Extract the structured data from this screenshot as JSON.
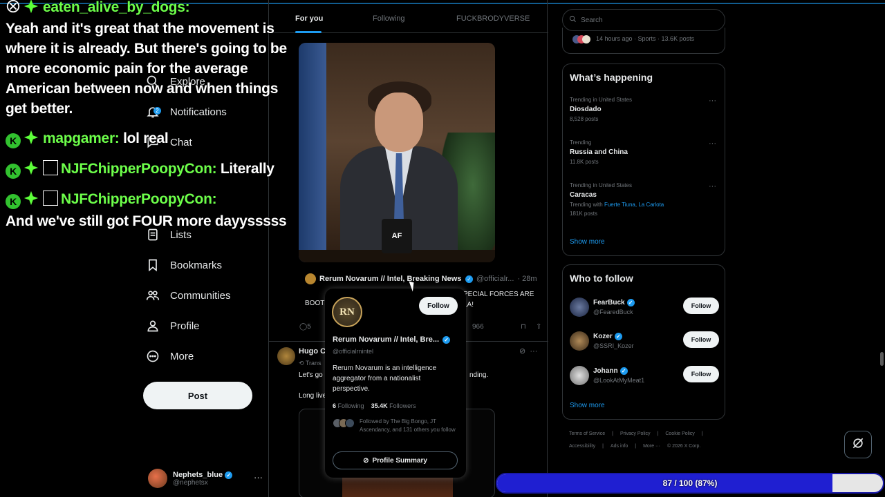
{
  "nav": {
    "items": [
      {
        "label": "Explore",
        "icon": "search-icon"
      },
      {
        "label": "Notifications",
        "icon": "bell-icon",
        "badge": "2"
      },
      {
        "label": "Chat",
        "icon": "chat-icon"
      },
      {
        "label": "Lists",
        "icon": "list-icon"
      },
      {
        "label": "Bookmarks",
        "icon": "bookmark-icon"
      },
      {
        "label": "Communities",
        "icon": "communities-icon"
      },
      {
        "label": "Profile",
        "icon": "profile-icon"
      },
      {
        "label": "More",
        "icon": "more-circle-icon"
      }
    ],
    "post_label": "Post",
    "account": {
      "name": "Nephets_blue",
      "handle": "@nephetsx",
      "more": "···"
    }
  },
  "feed": {
    "tabs": [
      "For you",
      "Following",
      "FUCKBRODYVERSE"
    ],
    "video": {
      "mug_text": "AF"
    },
    "tweet1": {
      "name": "Rerum Novarum // Intel, Breaking News, ...",
      "handle": "@officialr...",
      "time": "· 28m",
      "text_left": "BOOTS",
      "text_right": "PECIAL FORCES ARE\nLA!",
      "replies": "5",
      "views": "966"
    },
    "tweet2": {
      "name": "Hugo Co",
      "translate": "Trans",
      "text1": "Let's go l",
      "text1_end": "nding.",
      "text2": "Long live"
    }
  },
  "hovercard": {
    "avatar_text": "RN",
    "follow_label": "Follow",
    "name": "Rerum Novarum // Intel, Bre...",
    "handle": "@officialrnintel",
    "bio": "Rerum Novarum is an intelligence aggregator from a nationalist perspective.",
    "following_count": "6",
    "following_label": "Following",
    "followers_count": "35.4K",
    "followers_label": "Followers",
    "followed_by": "Followed by The Big Bongo, JT Ascendancy, and 131 others you follow",
    "summary_label": "Profile Summary"
  },
  "right": {
    "search_placeholder": "Search",
    "prev_meta": "14 hours ago · Sports · 13.6K posts",
    "happening": {
      "title": "What’s happening",
      "trends": [
        {
          "context": "Trending in United States",
          "name": "Diosdado",
          "count": "8,528 posts"
        },
        {
          "context": "Trending",
          "name": "Russia and China",
          "count": "11.8K posts"
        },
        {
          "context": "Trending in United States",
          "name": "Caracas",
          "with_label": "Trending with",
          "with_links": "Fuerte Tiuna, La Carlota",
          "count": "181K posts"
        }
      ],
      "show_more": "Show more"
    },
    "who_to_follow": {
      "title": "Who to follow",
      "users": [
        {
          "name": "FearBuck",
          "handle": "@FearedBuck",
          "button": "Follow"
        },
        {
          "name": "Kozer",
          "handle": "@SSRI_Kozer",
          "button": "Follow"
        },
        {
          "name": "Johann",
          "handle": "@LookAtMyMeat1",
          "button": "Follow"
        }
      ],
      "show_more": "Show more"
    },
    "footer": {
      "line1": [
        "Terms of Service",
        "|",
        "Privacy Policy",
        "|",
        "Cookie Policy",
        "|"
      ],
      "line2": [
        "Accessibility",
        "|",
        "Ads info",
        "|",
        "More ···",
        "© 2026 X Corp."
      ]
    }
  },
  "progress": {
    "label": "87 / 100 (87%)",
    "fraction": 0.87
  },
  "chat": [
    {
      "user": "eaten_alive_by_dogs:",
      "message": ""
    },
    {
      "user": "",
      "message": "Yeah and it's great that the movement is"
    },
    {
      "user": "",
      "message": "where it is already. But there's going to be"
    },
    {
      "user": "",
      "message": "more economic pain for the average"
    },
    {
      "user": "",
      "message": "American between now and when things"
    },
    {
      "user": "",
      "message": "get better."
    },
    {
      "user": "mapgamer:",
      "message": "lol real"
    },
    {
      "user": "NJFChipperPoopyCon:",
      "message": "Literally"
    },
    {
      "user": "NJFChipperPoopyCon:",
      "message": ""
    },
    {
      "user": "",
      "message": "And we've still got FOUR more dayysssss"
    }
  ],
  "chat_badge_letter": "K",
  "colors": {
    "accent": "#1d9bf0",
    "chat_username": "#6dff4a",
    "progress_fill": "#1f1fd1"
  }
}
